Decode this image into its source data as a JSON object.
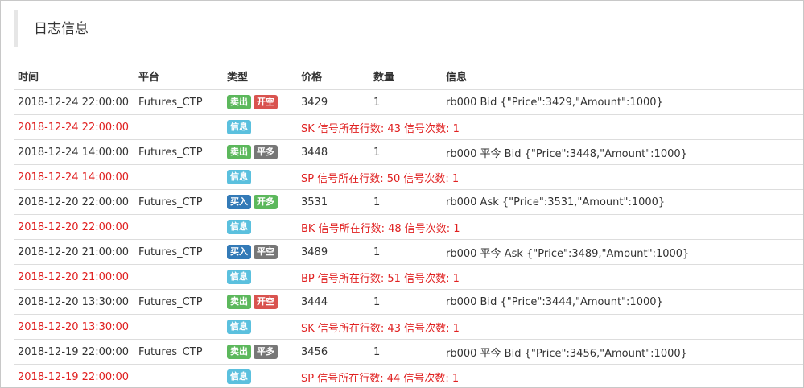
{
  "panel": {
    "title": "日志信息"
  },
  "table": {
    "headers": {
      "time": "时间",
      "platform": "平台",
      "type": "类型",
      "price": "价格",
      "amount": "数量",
      "message": "信息"
    },
    "rows": [
      {
        "kind": "order",
        "time": "2018-12-24 22:00:00",
        "platform": "Futures_CTP",
        "action": "卖出",
        "action_style": "sell",
        "direction": "开空",
        "direction_style": "open-short",
        "price": "3429",
        "amount": "1",
        "message": "rb000 Bid {\"Price\":3429,\"Amount\":1000}"
      },
      {
        "kind": "info",
        "time": "2018-12-24 22:00:00",
        "type": "信息",
        "message": "SK 信号所在行数: 43 信号次数: 1"
      },
      {
        "kind": "order",
        "time": "2018-12-24 14:00:00",
        "platform": "Futures_CTP",
        "action": "卖出",
        "action_style": "sell",
        "direction": "平多",
        "direction_style": "close",
        "price": "3448",
        "amount": "1",
        "message": "rb000 平今 Bid {\"Price\":3448,\"Amount\":1000}"
      },
      {
        "kind": "info",
        "time": "2018-12-24 14:00:00",
        "type": "信息",
        "message": "SP 信号所在行数: 50 信号次数: 1"
      },
      {
        "kind": "order",
        "time": "2018-12-20 22:00:00",
        "platform": "Futures_CTP",
        "action": "买入",
        "action_style": "buy",
        "direction": "开多",
        "direction_style": "open-long",
        "price": "3531",
        "amount": "1",
        "message": "rb000 Ask {\"Price\":3531,\"Amount\":1000}"
      },
      {
        "kind": "info",
        "time": "2018-12-20 22:00:00",
        "type": "信息",
        "message": "BK 信号所在行数: 48 信号次数: 1"
      },
      {
        "kind": "order",
        "time": "2018-12-20 21:00:00",
        "platform": "Futures_CTP",
        "action": "买入",
        "action_style": "buy",
        "direction": "平空",
        "direction_style": "close",
        "price": "3489",
        "amount": "1",
        "message": "rb000 平今 Ask {\"Price\":3489,\"Amount\":1000}"
      },
      {
        "kind": "info",
        "time": "2018-12-20 21:00:00",
        "type": "信息",
        "message": "BP 信号所在行数: 51 信号次数: 1"
      },
      {
        "kind": "order",
        "time": "2018-12-20 13:30:00",
        "platform": "Futures_CTP",
        "action": "卖出",
        "action_style": "sell",
        "direction": "开空",
        "direction_style": "open-short",
        "price": "3444",
        "amount": "1",
        "message": "rb000 Bid {\"Price\":3444,\"Amount\":1000}"
      },
      {
        "kind": "info",
        "time": "2018-12-20 13:30:00",
        "type": "信息",
        "message": "SK 信号所在行数: 43 信号次数: 1"
      },
      {
        "kind": "order",
        "time": "2018-12-19 22:00:00",
        "platform": "Futures_CTP",
        "action": "卖出",
        "action_style": "sell",
        "direction": "平多",
        "direction_style": "close",
        "price": "3456",
        "amount": "1",
        "message": "rb000 平今 Bid {\"Price\":3456,\"Amount\":1000}"
      },
      {
        "kind": "info",
        "time": "2018-12-19 22:00:00",
        "type": "信息",
        "message": "SP 信号所在行数: 44 信号次数: 1"
      }
    ]
  }
}
